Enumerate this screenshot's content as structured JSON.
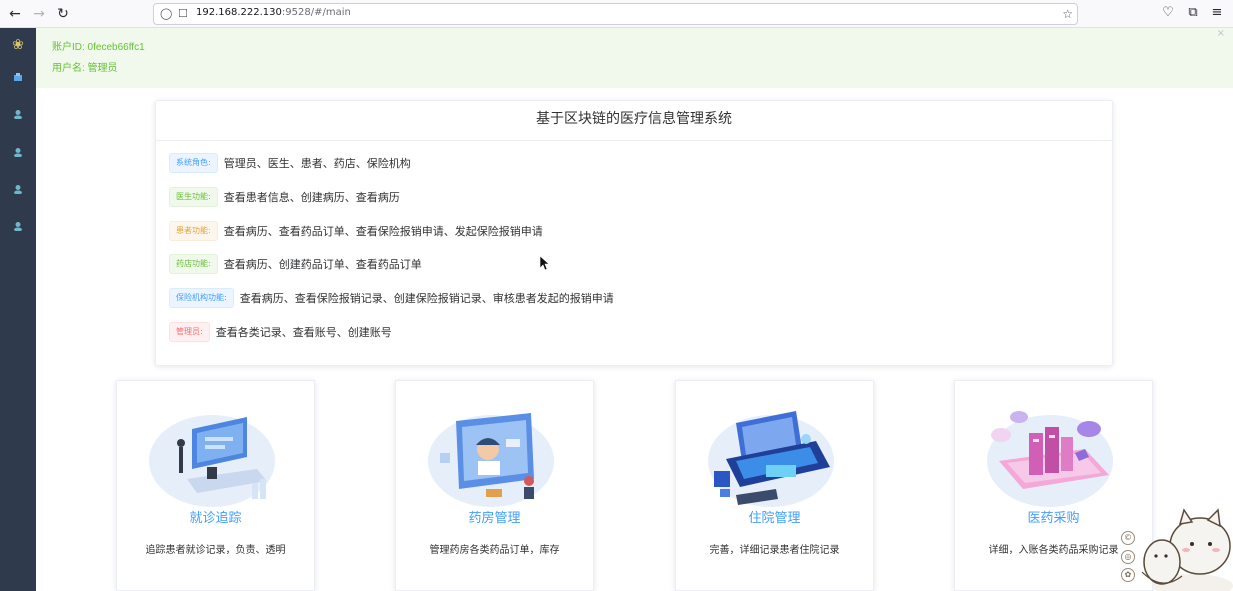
{
  "browser": {
    "url_host": "192.168.222.130",
    "url_rest": ":9528/#/main"
  },
  "sidebar": {
    "items": [
      {
        "icon": "logo-icon"
      },
      {
        "icon": "home-icon"
      },
      {
        "icon": "user-icon"
      },
      {
        "icon": "user-icon"
      },
      {
        "icon": "user-icon"
      },
      {
        "icon": "user-icon"
      }
    ]
  },
  "account": {
    "id_line": "账户ID: 0feceb66ffc1",
    "name_line": "用户名: 管理员"
  },
  "info": {
    "title": "基于区块链的医疗信息管理系统",
    "rows": [
      {
        "tag": "系统角色:",
        "text": "管理员、医生、患者、药店、保险机构"
      },
      {
        "tag": "医生功能:",
        "text": "查看患者信息、创建病历、查看病历"
      },
      {
        "tag": "患者功能:",
        "text": "查看病历、查看药品订单、查看保险报销申请、发起保险报销申请"
      },
      {
        "tag": "药店功能:",
        "text": "查看病历、创建药品订单、查看药品订单"
      },
      {
        "tag": "保险机构功能:",
        "text": "查看病历、查看保险报销记录、创建保险报销记录、审核患者发起的报销申请"
      },
      {
        "tag": "管理员:",
        "text": "查看各类记录、查看账号、创建账号"
      }
    ]
  },
  "features": [
    {
      "title": "就诊追踪",
      "desc": "追踪患者就诊记录，负责、透明"
    },
    {
      "title": "药房管理",
      "desc": "管理药房各类药品订单，库存"
    },
    {
      "title": "住院管理",
      "desc": "完善，详细记录患者住院记录"
    },
    {
      "title": "医药采购",
      "desc": "详细，入账各类药品采购记录"
    }
  ],
  "colors": {
    "sidebar": "#2f3a4d",
    "accent": "#409eff",
    "success": "#67c23a",
    "banner_bg": "#f0f9eb"
  }
}
